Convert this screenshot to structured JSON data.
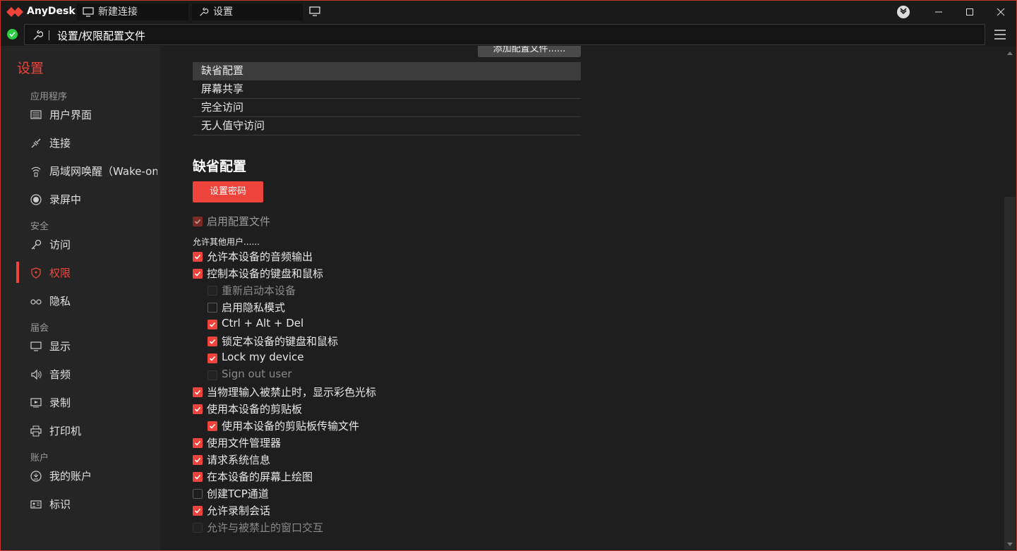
{
  "app": {
    "name": "AnyDesk"
  },
  "tabs": [
    {
      "label": "新建连接",
      "icon": "monitor-icon"
    },
    {
      "label": "设置",
      "icon": "wrench-icon"
    }
  ],
  "address": {
    "text": "设置/权限配置文件",
    "status": "connected"
  },
  "sidebar": {
    "title": "设置",
    "sections": [
      {
        "label": "应用程序"
      },
      {
        "label": "安全"
      },
      {
        "label": "届会"
      },
      {
        "label": "账户"
      }
    ],
    "items": [
      {
        "label": "用户界面",
        "icon": "ui-icon"
      },
      {
        "label": "连接",
        "icon": "connection-icon"
      },
      {
        "label": "局域网唤醒（Wake-on-LAN）",
        "icon": "wake-icon"
      },
      {
        "label": "录屏中",
        "icon": "record-icon"
      },
      {
        "label": "访问",
        "icon": "key-icon"
      },
      {
        "label": "权限",
        "icon": "shield-icon",
        "active": true
      },
      {
        "label": "隐私",
        "icon": "glasses-icon"
      },
      {
        "label": "显示",
        "icon": "display-icon"
      },
      {
        "label": "音频",
        "icon": "speaker-icon"
      },
      {
        "label": "录制",
        "icon": "play-icon"
      },
      {
        "label": "打印机",
        "icon": "printer-icon"
      },
      {
        "label": "我的账户",
        "icon": "account-icon"
      },
      {
        "label": "标识",
        "icon": "id-card-icon"
      }
    ]
  },
  "profiles": {
    "add_button": "添加配置文件......",
    "list": [
      "缺省配置",
      "屏幕共享",
      "完全访问",
      "无人值守访问"
    ],
    "selected": "缺省配置"
  },
  "detail": {
    "heading": "缺省配置",
    "set_password": "设置密码",
    "enable_profile": {
      "label": "启用配置文件",
      "checked": true,
      "disabled": true
    },
    "allow_others": "允许其他用户......",
    "permissions": [
      {
        "label": "允许本设备的音频输出",
        "checked": true,
        "state": "on"
      },
      {
        "label": "控制本设备的键盘和鼠标",
        "checked": true,
        "state": "on"
      },
      {
        "label": "重新启动本设备",
        "checked": false,
        "state": "disabled",
        "indent": true
      },
      {
        "label": "启用隐私模式",
        "checked": false,
        "state": "off",
        "indent": true
      },
      {
        "label": "Ctrl + Alt + Del",
        "checked": true,
        "state": "on",
        "indent": true
      },
      {
        "label": "锁定本设备的键盘和鼠标",
        "checked": true,
        "state": "on",
        "indent": true
      },
      {
        "label": "Lock my device",
        "checked": true,
        "state": "on",
        "indent": true
      },
      {
        "label": "Sign out user",
        "checked": false,
        "state": "disabled",
        "indent": true
      },
      {
        "label": "当物理输入被禁止时，显示彩色光标",
        "checked": true,
        "state": "on"
      },
      {
        "label": "使用本设备的剪贴板",
        "checked": true,
        "state": "on"
      },
      {
        "label": "使用本设备的剪贴板传输文件",
        "checked": true,
        "state": "on",
        "indent": true
      },
      {
        "label": "使用文件管理器",
        "checked": true,
        "state": "on"
      },
      {
        "label": "请求系统信息",
        "checked": true,
        "state": "on"
      },
      {
        "label": "在本设备的屏幕上绘图",
        "checked": true,
        "state": "on"
      },
      {
        "label": "创建TCP通道",
        "checked": false,
        "state": "off"
      },
      {
        "label": "允许录制会话",
        "checked": true,
        "state": "on"
      },
      {
        "label": "允许与被禁止的窗口交互",
        "checked": false,
        "state": "disabled"
      }
    ]
  },
  "colors": {
    "accent": "#ef443b",
    "bg": "#1e1e1e",
    "sidebar": "#252525",
    "ok": "#2ecc40"
  }
}
